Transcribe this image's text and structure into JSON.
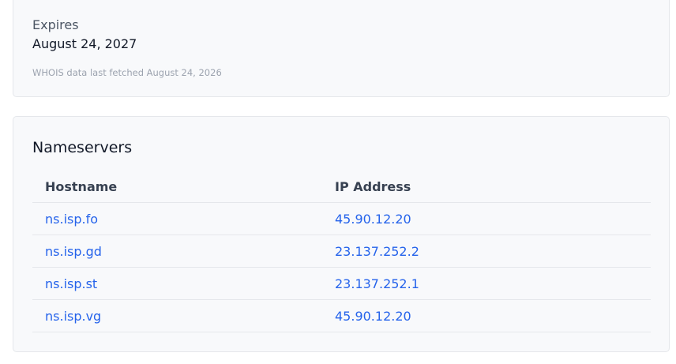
{
  "whois": {
    "expires_label": "Expires",
    "expires_value": "August 24, 2027",
    "fetched_note": "WHOIS data last fetched August 24, 2026"
  },
  "nameservers": {
    "title": "Nameservers",
    "columns": {
      "hostname": "Hostname",
      "ip": "IP Address"
    },
    "rows": [
      {
        "hostname": "ns.isp.fo",
        "ip": "45.90.12.20"
      },
      {
        "hostname": "ns.isp.gd",
        "ip": "23.137.252.2"
      },
      {
        "hostname": "ns.isp.st",
        "ip": "23.137.252.1"
      },
      {
        "hostname": "ns.isp.vg",
        "ip": "45.90.12.20"
      }
    ]
  },
  "colors": {
    "link": "#2563eb",
    "card_background": "#f8f9fb",
    "border": "#e5e7eb"
  }
}
